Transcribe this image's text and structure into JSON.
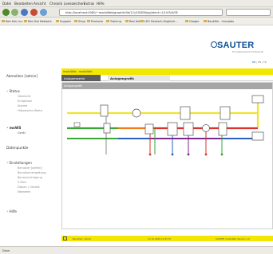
{
  "browser": {
    "menu": [
      "Datei",
      "Bearbeiten",
      "Ansicht",
      "Chronik",
      "Lesezeichen",
      "Extras",
      "Hilfe"
    ],
    "url": "http://localhost:4080/~moduWeb/graphik/lib/1/1/43/SE6/pg/ident=1/1/43/4/SE",
    "bookmarks": [
      "Red Hat, Inc.",
      "Red Hat Network",
      "Support",
      "Shop",
      "Products",
      "Training",
      "Red Hat",
      "LEO Deutsch-Englisch...",
      "Google",
      "Bankfile - Cronjobs"
    ],
    "status": "Done"
  },
  "brand": {
    "logo": "SAUTER",
    "tagline": "Für Lebensräume mit Zukunft",
    "languages": [
      "DE",
      "EN",
      "FR"
    ]
  },
  "sidebar": {
    "sections": [
      {
        "label": "Abmelden [admin]",
        "items": []
      },
      {
        "label": "Status",
        "items": [
          "Übersicht",
          "Ereignisse",
          "Alarme",
          "Historische Werte"
        ]
      },
      {
        "label": "moWS",
        "items": [
          "Gerät"
        ]
      },
      {
        "label": "Datenpunkte",
        "items": []
      },
      {
        "label": "Einstellungen",
        "items": [
          "Benutzer [admin]",
          "Benutzerverwaltung",
          "Benachrichtigung",
          "E-Mail",
          "Datum / Uhrzeit",
          "Netzwerk"
        ]
      },
      {
        "label": "Hilfe",
        "items": []
      }
    ]
  },
  "content": {
    "breadcrumb": "moduWeb - moduWeb",
    "tabs": [
      "Anlagenwerte",
      "Anlagengrafik"
    ],
    "active_tab": 1,
    "panel_title": "Anlagengrafik"
  },
  "footer": {
    "left": "Benutzer: Admin",
    "mid": "12.10.2009 14:05:07",
    "right": "SAUTER moduWeb Version 1.0"
  },
  "colors": {
    "accent": "#f3e600",
    "brand": "#0e4f93",
    "pipe_yellow": "#f0e430",
    "pipe_green": "#3aa635",
    "pipe_orange": "#ef7d1a",
    "pipe_red": "#d9332a",
    "pipe_blue": "#2b5fbf",
    "pipe_purple": "#7a2a8a"
  }
}
